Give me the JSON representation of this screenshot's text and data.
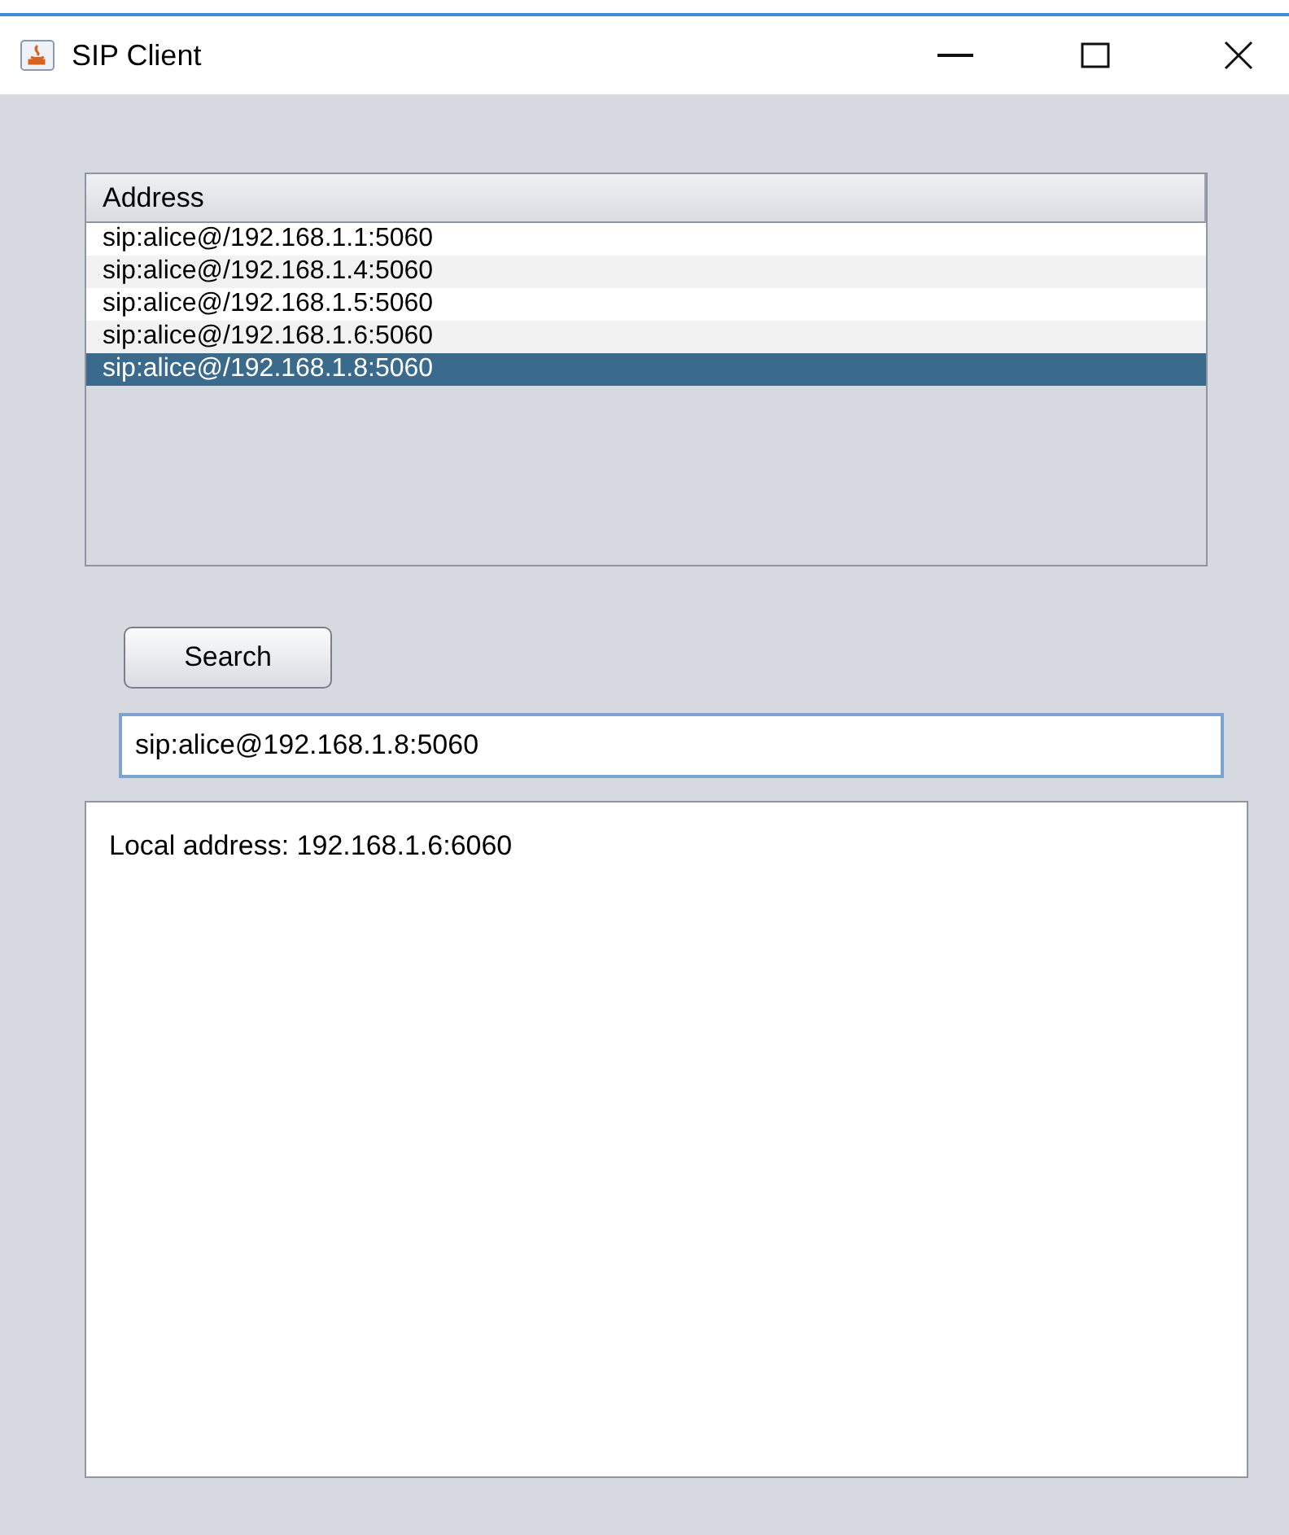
{
  "window": {
    "title": "SIP Client"
  },
  "table": {
    "columns": [
      "Address"
    ],
    "rows": [
      {
        "address": "sip:alice@/192.168.1.1:5060",
        "selected": false
      },
      {
        "address": "sip:alice@/192.168.1.4:5060",
        "selected": false
      },
      {
        "address": "sip:alice@/192.168.1.5:5060",
        "selected": false
      },
      {
        "address": "sip:alice@/192.168.1.6:5060",
        "selected": false
      },
      {
        "address": "sip:alice@/192.168.1.8:5060",
        "selected": true
      }
    ]
  },
  "search_button": "Search",
  "address_field": {
    "value": "sip:alice@192.168.1.8:5060"
  },
  "log": {
    "text": "Local address: 192.168.1.6:6060"
  }
}
